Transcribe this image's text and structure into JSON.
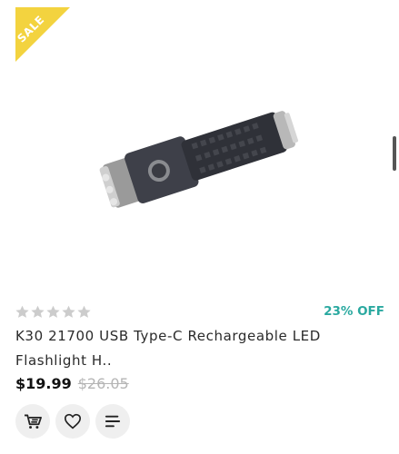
{
  "badge": {
    "sale_label": "SALE",
    "color": "#f3d33f"
  },
  "product": {
    "rating": {
      "value": 0,
      "max": 5
    },
    "discount_label": "23% OFF",
    "title": "K30 21700 USB Type-C Rechargeable LED Flashlight H..",
    "price": "$19.99",
    "old_price": "$26.05"
  },
  "actions": [
    {
      "icon": "add-to-cart-icon"
    },
    {
      "icon": "wishlist-heart-icon"
    },
    {
      "icon": "compare-list-icon"
    }
  ],
  "colors": {
    "accent": "#2aa9a0",
    "star_empty": "#cccccc"
  }
}
